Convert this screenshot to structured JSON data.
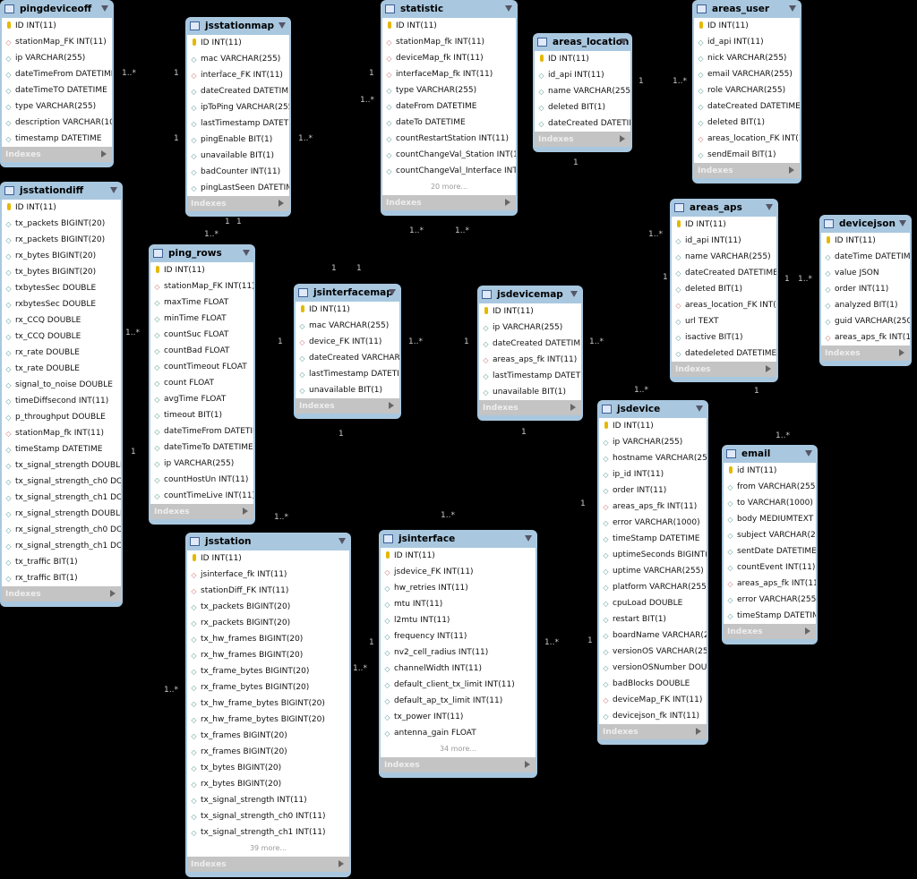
{
  "indexes_label": "Indexes",
  "tables": [
    {
      "name": "pingdeviceoff",
      "rows": [
        [
          "key",
          "ID INT(11)"
        ],
        [
          "fk",
          "stationMap_FK INT(11)"
        ],
        [
          "col",
          "ip VARCHAR(255)"
        ],
        [
          "col",
          "dateTimeFrom DATETIME"
        ],
        [
          "col",
          "dateTimeTO DATETIME"
        ],
        [
          "col",
          "type VARCHAR(255)"
        ],
        [
          "col",
          "description VARCHAR(1000)"
        ],
        [
          "col",
          "timestamp DATETIME"
        ]
      ]
    },
    {
      "name": "jsstationmap",
      "rows": [
        [
          "key",
          "ID INT(11)"
        ],
        [
          "col",
          "mac VARCHAR(255)"
        ],
        [
          "fk",
          "interface_FK INT(11)"
        ],
        [
          "col",
          "dateCreated DATETIME"
        ],
        [
          "col",
          "ipToPing VARCHAR(255)"
        ],
        [
          "col",
          "lastTimestamp DATETIME"
        ],
        [
          "col",
          "pingEnable BIT(1)"
        ],
        [
          "col",
          "unavailable BIT(1)"
        ],
        [
          "col",
          "badCounter INT(11)"
        ],
        [
          "col",
          "pingLastSeen DATETIME"
        ]
      ]
    },
    {
      "name": "statistic",
      "rows": [
        [
          "key",
          "ID INT(11)"
        ],
        [
          "fk",
          "stationMap_fk INT(11)"
        ],
        [
          "fk",
          "deviceMap_fk INT(11)"
        ],
        [
          "fk",
          "interfaceMap_fk INT(11)"
        ],
        [
          "col",
          "type VARCHAR(255)"
        ],
        [
          "col",
          "dateFrom DATETIME"
        ],
        [
          "col",
          "dateTo DATETIME"
        ],
        [
          "col",
          "countRestartStation INT(11)"
        ],
        [
          "col",
          "countChangeVal_Station INT(11)"
        ],
        [
          "col",
          "countChangeVal_Interface INT(1..."
        ]
      ],
      "more": "20 more..."
    },
    {
      "name": "areas_location",
      "rows": [
        [
          "key",
          "ID INT(11)"
        ],
        [
          "col",
          "id_api INT(11)"
        ],
        [
          "col",
          "name VARCHAR(255)"
        ],
        [
          "col",
          "deleted BIT(1)"
        ],
        [
          "col",
          "dateCreated DATETIME"
        ]
      ]
    },
    {
      "name": "areas_user",
      "rows": [
        [
          "key",
          "ID INT(11)"
        ],
        [
          "col",
          "id_api INT(11)"
        ],
        [
          "col",
          "nick VARCHAR(255)"
        ],
        [
          "col",
          "email VARCHAR(255)"
        ],
        [
          "col",
          "role VARCHAR(255)"
        ],
        [
          "col",
          "dateCreated DATETIME"
        ],
        [
          "col",
          "deleted BIT(1)"
        ],
        [
          "fk",
          "areas_location_FK INT(11)"
        ],
        [
          "col",
          "sendEmail BIT(1)"
        ]
      ]
    },
    {
      "name": "jsstationdiff",
      "rows": [
        [
          "key",
          "ID INT(11)"
        ],
        [
          "col",
          "tx_packets BIGINT(20)"
        ],
        [
          "col",
          "rx_packets BIGINT(20)"
        ],
        [
          "col",
          "rx_bytes BIGINT(20)"
        ],
        [
          "col",
          "tx_bytes BIGINT(20)"
        ],
        [
          "col",
          "txbytesSec DOUBLE"
        ],
        [
          "col",
          "rxbytesSec DOUBLE"
        ],
        [
          "col",
          "rx_CCQ DOUBLE"
        ],
        [
          "col",
          "tx_CCQ DOUBLE"
        ],
        [
          "col",
          "rx_rate DOUBLE"
        ],
        [
          "col",
          "tx_rate DOUBLE"
        ],
        [
          "col",
          "signal_to_noise DOUBLE"
        ],
        [
          "col",
          "timeDiffsecond INT(11)"
        ],
        [
          "col",
          "p_throughput DOUBLE"
        ],
        [
          "fk",
          "stationMap_fk INT(11)"
        ],
        [
          "col",
          "timeStamp DATETIME"
        ],
        [
          "col",
          "tx_signal_strength DOUBLE"
        ],
        [
          "col",
          "tx_signal_strength_ch0 DOU..."
        ],
        [
          "col",
          "tx_signal_strength_ch1 DOU..."
        ],
        [
          "col",
          "rx_signal_strength DOUBLE"
        ],
        [
          "col",
          "rx_signal_strength_ch0 DOU..."
        ],
        [
          "col",
          "rx_signal_strength_ch1 DOU..."
        ],
        [
          "col",
          "tx_traffic BIT(1)"
        ],
        [
          "col",
          "rx_traffic BIT(1)"
        ]
      ]
    },
    {
      "name": "ping_rows",
      "rows": [
        [
          "key",
          "ID INT(11)"
        ],
        [
          "fk",
          "stationMap_FK INT(11)"
        ],
        [
          "col",
          "maxTime FLOAT"
        ],
        [
          "col",
          "minTime FLOAT"
        ],
        [
          "col",
          "countSuc FLOAT"
        ],
        [
          "col",
          "countBad FLOAT"
        ],
        [
          "col",
          "countTimeout FLOAT"
        ],
        [
          "col",
          "count FLOAT"
        ],
        [
          "col",
          "avgTime FLOAT"
        ],
        [
          "col",
          "timeout BIT(1)"
        ],
        [
          "col",
          "dateTimeFrom DATETIME"
        ],
        [
          "col",
          "dateTimeTo DATETIME"
        ],
        [
          "col",
          "ip VARCHAR(255)"
        ],
        [
          "col",
          "countHostUn INT(11)"
        ],
        [
          "col",
          "countTimeLive INT(11)"
        ]
      ]
    },
    {
      "name": "jsinterfacemap",
      "rows": [
        [
          "key",
          "ID INT(11)"
        ],
        [
          "col",
          "mac VARCHAR(255)"
        ],
        [
          "fk",
          "device_FK INT(11)"
        ],
        [
          "col",
          "dateCreated VARCHAR(2..."
        ],
        [
          "col",
          "lastTimestamp DATETIME"
        ],
        [
          "col",
          "unavailable BIT(1)"
        ]
      ]
    },
    {
      "name": "jsdevicemap",
      "rows": [
        [
          "key",
          "ID INT(11)"
        ],
        [
          "col",
          "ip VARCHAR(255)"
        ],
        [
          "col",
          "dateCreated DATETIME"
        ],
        [
          "fk",
          "areas_aps_fk INT(11)"
        ],
        [
          "col",
          "lastTimestamp DATETIME"
        ],
        [
          "col",
          "unavailable BIT(1)"
        ]
      ]
    },
    {
      "name": "areas_aps",
      "rows": [
        [
          "key",
          "ID INT(11)"
        ],
        [
          "col",
          "id_api INT(11)"
        ],
        [
          "col",
          "name VARCHAR(255)"
        ],
        [
          "col",
          "dateCreated DATETIME"
        ],
        [
          "col",
          "deleted BIT(1)"
        ],
        [
          "fk",
          "areas_location_FK INT(11)"
        ],
        [
          "col",
          "url TEXT"
        ],
        [
          "col",
          "isactive BIT(1)"
        ],
        [
          "col",
          "datedeleted DATETIME"
        ]
      ]
    },
    {
      "name": "devicejson",
      "rows": [
        [
          "key",
          "ID INT(11)"
        ],
        [
          "col",
          "dateTime DATETIME"
        ],
        [
          "col",
          "value JSON"
        ],
        [
          "col",
          "order INT(11)"
        ],
        [
          "col",
          "analyzed BIT(1)"
        ],
        [
          "col",
          "guid VARCHAR(250)"
        ],
        [
          "fk",
          "areas_aps_fk INT(11)"
        ]
      ]
    },
    {
      "name": "jsdevice",
      "rows": [
        [
          "key",
          "ID INT(11)"
        ],
        [
          "col",
          "ip VARCHAR(255)"
        ],
        [
          "col",
          "hostname VARCHAR(255)"
        ],
        [
          "col",
          "ip_id INT(11)"
        ],
        [
          "col",
          "order INT(11)"
        ],
        [
          "fk",
          "areas_aps_fk INT(11)"
        ],
        [
          "col",
          "error VARCHAR(1000)"
        ],
        [
          "col",
          "timeStamp DATETIME"
        ],
        [
          "col",
          "uptimeSeconds BIGINT(20)"
        ],
        [
          "col",
          "uptime VARCHAR(255)"
        ],
        [
          "col",
          "platform VARCHAR(255)"
        ],
        [
          "col",
          "cpuLoad DOUBLE"
        ],
        [
          "col",
          "restart BIT(1)"
        ],
        [
          "col",
          "boardName VARCHAR(255)"
        ],
        [
          "col",
          "versionOS VARCHAR(255)"
        ],
        [
          "col",
          "versionOSNumber DOUBLE"
        ],
        [
          "col",
          "badBlocks DOUBLE"
        ],
        [
          "fk",
          "deviceMap_FK INT(11)"
        ],
        [
          "col",
          "devicejson_fk INT(11)"
        ]
      ]
    },
    {
      "name": "email",
      "rows": [
        [
          "key",
          "id INT(11)"
        ],
        [
          "col",
          "from VARCHAR(255)"
        ],
        [
          "col",
          "to VARCHAR(1000)"
        ],
        [
          "col",
          "body MEDIUMTEXT"
        ],
        [
          "col",
          "subject VARCHAR(255)"
        ],
        [
          "col",
          "sentDate DATETIME"
        ],
        [
          "col",
          "countEvent INT(11)"
        ],
        [
          "fk",
          "areas_aps_fk INT(11)"
        ],
        [
          "col",
          "error VARCHAR(255)"
        ],
        [
          "col",
          "timeStamp DATETIME"
        ]
      ]
    },
    {
      "name": "jsstation",
      "rows": [
        [
          "key",
          "ID INT(11)"
        ],
        [
          "fk",
          "jsinterface_fk INT(11)"
        ],
        [
          "fk",
          "stationDiff_FK INT(11)"
        ],
        [
          "col",
          "tx_packets BIGINT(20)"
        ],
        [
          "col",
          "rx_packets BIGINT(20)"
        ],
        [
          "col",
          "tx_hw_frames BIGINT(20)"
        ],
        [
          "col",
          "rx_hw_frames BIGINT(20)"
        ],
        [
          "col",
          "tx_frame_bytes BIGINT(20)"
        ],
        [
          "col",
          "rx_frame_bytes BIGINT(20)"
        ],
        [
          "col",
          "tx_hw_frame_bytes BIGINT(20)"
        ],
        [
          "col",
          "rx_hw_frame_bytes BIGINT(20)"
        ],
        [
          "col",
          "tx_frames BIGINT(20)"
        ],
        [
          "col",
          "rx_frames BIGINT(20)"
        ],
        [
          "col",
          "tx_bytes BIGINT(20)"
        ],
        [
          "col",
          "rx_bytes BIGINT(20)"
        ],
        [
          "col",
          "tx_signal_strength INT(11)"
        ],
        [
          "col",
          "tx_signal_strength_ch0 INT(11)"
        ],
        [
          "col",
          "tx_signal_strength_ch1 INT(11)"
        ]
      ],
      "more": "39 more..."
    },
    {
      "name": "jsinterface",
      "rows": [
        [
          "key",
          "ID INT(11)"
        ],
        [
          "fk",
          "jsdevice_FK INT(11)"
        ],
        [
          "col",
          "hw_retries INT(11)"
        ],
        [
          "col",
          "mtu INT(11)"
        ],
        [
          "col",
          "l2mtu INT(11)"
        ],
        [
          "col",
          "frequency INT(11)"
        ],
        [
          "col",
          "nv2_cell_radius INT(11)"
        ],
        [
          "col",
          "channelWidth INT(11)"
        ],
        [
          "col",
          "default_client_tx_limit INT(11)"
        ],
        [
          "col",
          "default_ap_tx_limit INT(11)"
        ],
        [
          "col",
          "tx_power INT(11)"
        ],
        [
          "col",
          "antenna_gain FLOAT"
        ]
      ],
      "more": "34 more..."
    }
  ],
  "cardinalities": [
    "1..*",
    "1",
    "1",
    "1..*",
    "1",
    "1..*",
    "1",
    "1",
    "1",
    "1..*",
    "1..*",
    "1",
    "1",
    "1..*",
    "1",
    "1..*",
    "1..*",
    "1",
    "1..*",
    "1",
    "1..*",
    "1",
    "1",
    "1",
    "1",
    "1..*",
    "1..*",
    "1..*",
    "1",
    "1",
    "1",
    "1..*",
    "1..*",
    "1..*",
    "1..*",
    "1",
    "1..*",
    "1",
    "1",
    "1..*"
  ]
}
